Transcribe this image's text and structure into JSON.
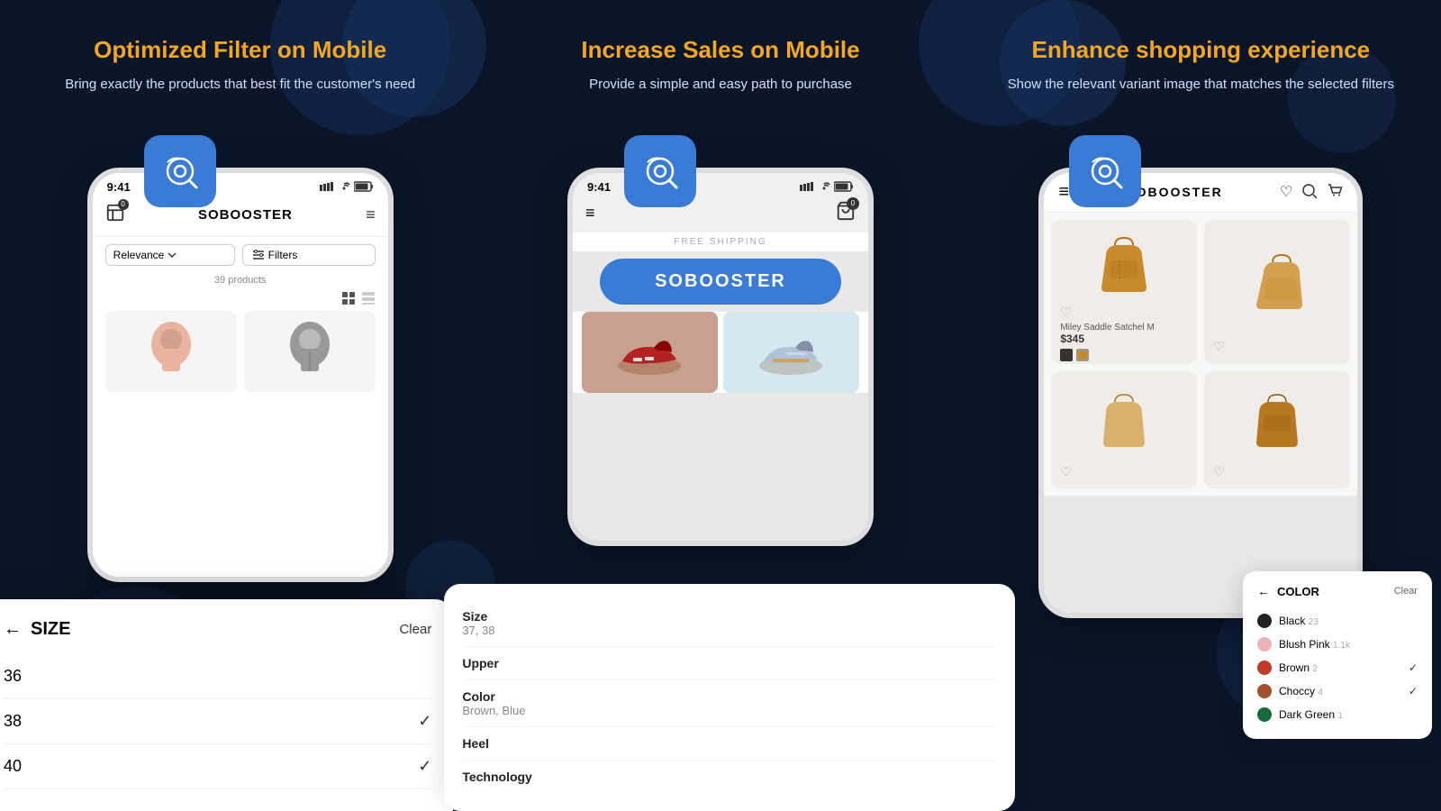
{
  "background": {
    "color": "#0a1628"
  },
  "columns": [
    {
      "id": "filter",
      "title": "Optimized Filter on Mobile",
      "description": "Bring exactly the products that best fit the customer's need",
      "phone": {
        "time": "9:41",
        "brand": "SOBOOSTER",
        "sort_label": "Relevance",
        "filters_label": "Filters",
        "products_count": "39 products"
      },
      "size_panel": {
        "title": "SIZE",
        "clear": "Clear",
        "items": [
          {
            "value": "36",
            "selected": false
          },
          {
            "value": "38",
            "selected": true
          },
          {
            "value": "40",
            "selected": true
          }
        ]
      }
    },
    {
      "id": "sales",
      "title": "Increase Sales on Mobile",
      "description": "Provide a simple and easy path to purchase",
      "phone": {
        "time": "9:41",
        "free_shipping": "FREE SHIPPING",
        "brand": "SOBOOSTER"
      },
      "product_panel": {
        "attributes": [
          {
            "label": "Size",
            "value": "37, 38"
          },
          {
            "label": "Upper",
            "value": ""
          },
          {
            "label": "Color",
            "value": "Brown, Blue"
          },
          {
            "label": "Heel",
            "value": ""
          },
          {
            "label": "Technology",
            "value": ""
          }
        ]
      }
    },
    {
      "id": "experience",
      "title": "Enhance shopping experience",
      "description": "Show the relevant variant image that matches the selected filters",
      "phone": {
        "brand": "SOBOOSTER"
      },
      "product": {
        "name": "Miley Saddle Satchel M",
        "price": "$345"
      },
      "color_panel": {
        "title": "COLOR",
        "clear": "Clear",
        "colors": [
          {
            "name": "Black",
            "count": "23",
            "hex": "#222222",
            "selected": false
          },
          {
            "name": "Blush Pink",
            "count": "1.1k",
            "hex": "#e8b4b8",
            "selected": false
          },
          {
            "name": "Brown",
            "count": "2",
            "hex": "#c0392b",
            "selected": true
          },
          {
            "name": "Choccy",
            "count": "4",
            "hex": "#a0522d",
            "selected": true
          },
          {
            "name": "Dark Green",
            "count": "1",
            "hex": "#1a6b3c",
            "selected": false
          }
        ]
      }
    }
  ],
  "icons": {
    "back_arrow": "←",
    "checkmark": "✓",
    "hamburger": "≡",
    "heart": "♡",
    "search": "🔍",
    "cart": "🛍"
  }
}
